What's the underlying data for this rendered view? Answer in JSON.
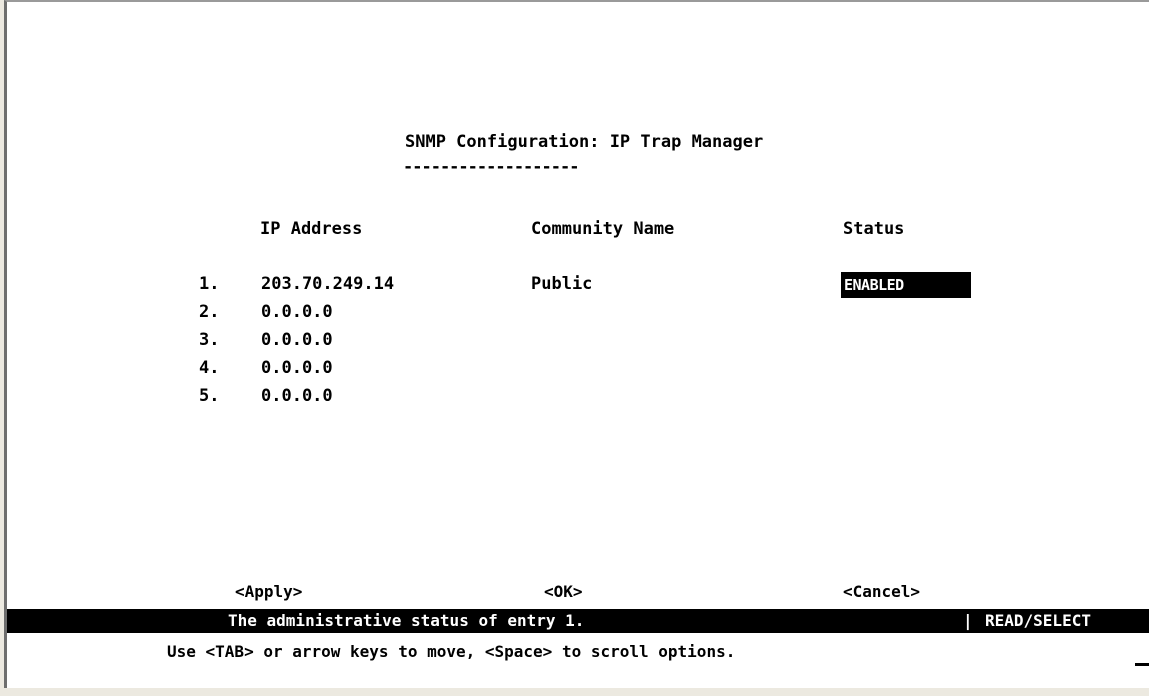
{
  "screen": {
    "title": "SNMP Configuration: IP Trap Manager",
    "title_underline": "-------------------"
  },
  "table": {
    "headers": {
      "ip_address": "IP Address",
      "community_name": "Community Name",
      "status": "Status"
    },
    "rows": [
      {
        "num": "1.",
        "ip": "203.70.249.14",
        "community": "Public",
        "status": "ENABLED"
      },
      {
        "num": "2.",
        "ip": "0.0.0.0",
        "community": "",
        "status": ""
      },
      {
        "num": "3.",
        "ip": "0.0.0.0",
        "community": "",
        "status": ""
      },
      {
        "num": "4.",
        "ip": "0.0.0.0",
        "community": "",
        "status": ""
      },
      {
        "num": "5.",
        "ip": "0.0.0.0",
        "community": "",
        "status": ""
      }
    ]
  },
  "buttons": {
    "apply": "<Apply>",
    "ok": "<OK>",
    "cancel": "<Cancel>"
  },
  "statusbar": {
    "message": "The administrative status of entry 1.",
    "separator": "|",
    "mode": "READ/SELECT"
  },
  "help_text": "Use <TAB> or arrow keys to move, <Space> to scroll options.",
  "colors": {
    "background": "#ffffff",
    "text": "#000000",
    "highlight_bg": "#000000",
    "highlight_text": "#ffffff"
  }
}
